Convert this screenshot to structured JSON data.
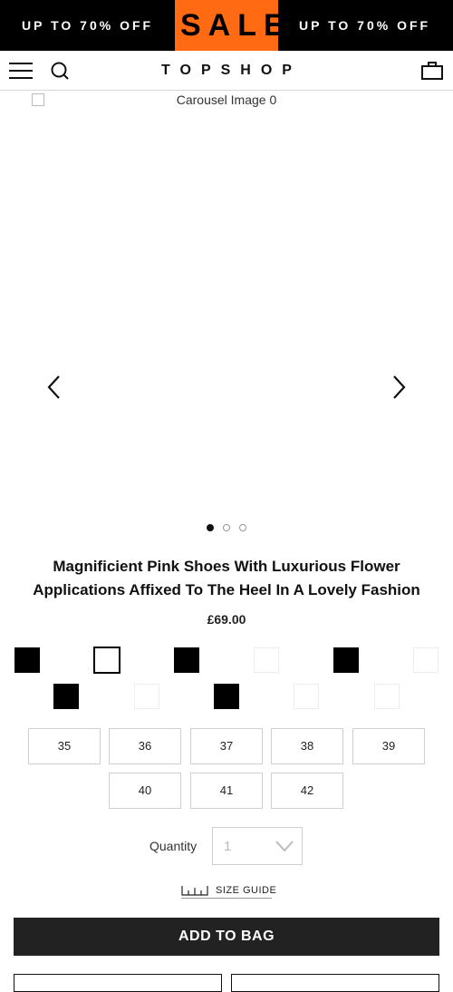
{
  "banner": {
    "left_text": "UP TO 70% OFF",
    "sale_text": "SALE",
    "right_text": "UP TO 70% OFF",
    "sale_color": "#ff6a13"
  },
  "header": {
    "logo": "TOPSHOP",
    "icons": [
      "hamburger-menu-icon",
      "search-icon",
      "shopping-bag-icon"
    ]
  },
  "carousel": {
    "image_alt": "Carousel Image 0",
    "prev_icon": "chevron-left-icon",
    "next_icon": "chevron-right-icon",
    "slide_count": 3,
    "active_slide": 1
  },
  "product": {
    "title": "Magnificient Pink Shoes With Luxurious Flower Applications Affixed To The Heel In A Lovely Fashion",
    "price": "£69.00"
  },
  "swatches": [
    {
      "color": "#000000",
      "selected": false
    },
    {
      "color": "#ffffff",
      "selected": true
    },
    {
      "color": "#000000",
      "selected": false
    },
    {
      "color": "#ffffff",
      "selected": false
    },
    {
      "color": "#000000",
      "selected": false
    },
    {
      "color": "#ffffff",
      "selected": false
    },
    {
      "color": "#000000",
      "selected": false
    },
    {
      "color": "#ffffff",
      "selected": false
    },
    {
      "color": "#000000",
      "selected": false
    },
    {
      "color": "#ffffff",
      "selected": false
    },
    {
      "color": "#ffffff",
      "selected": false
    }
  ],
  "sizes": [
    "35",
    "36",
    "37",
    "38",
    "39",
    "40",
    "41",
    "42"
  ],
  "quantity": {
    "label": "Quantity",
    "value": "1"
  },
  "size_guide": {
    "label": "SIZE GUIDE",
    "icon": "ruler-icon"
  },
  "add_to_bag": {
    "label": "ADD TO BAG",
    "color": "#222222"
  }
}
